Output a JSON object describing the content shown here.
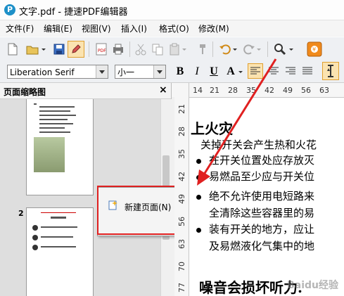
{
  "window": {
    "title": "文字.pdf - 捷速PDF编辑器",
    "app_icon_glyph": "P"
  },
  "menu": [
    {
      "label": "文件(F)"
    },
    {
      "label": "编辑(E)"
    },
    {
      "label": "视图(V)"
    },
    {
      "label": "插入(I)"
    },
    {
      "label": "格式(O)"
    },
    {
      "label": "修改(M)"
    }
  ],
  "toolbar": {
    "font_family": "Liberation Serif",
    "font_size": "小一",
    "bold": "B",
    "italic": "I",
    "underline": "U",
    "text_color": "A"
  },
  "thumbnails": {
    "title": "页面缩略图",
    "close_glyph": "×",
    "page2_number": "2"
  },
  "ruler": {
    "h_ticks": [
      "14",
      "21",
      "28",
      "35",
      "42",
      "49",
      "56",
      "63"
    ],
    "v_ticks": [
      "21",
      "28",
      "35",
      "42",
      "49",
      "56",
      "63",
      "70",
      "77"
    ]
  },
  "document": {
    "heading1": "上火灾",
    "line1": "关掉开关会产生热和火花",
    "bullet1": "在开关位置处应存放灭",
    "bullet2": "易燃品至少应与开关位",
    "bullet3a": "绝不允许使用电短路来",
    "bullet3b": "全清除这些容器里的易",
    "bullet4a": "装有开关的地方，应让",
    "bullet4b": "及易燃液化气集中的地",
    "heading2": "噪音会损坏听力."
  },
  "context_menu": {
    "item_label": "新建页面(N)"
  },
  "colors": {
    "annotation_red": "#e02020",
    "app_icon": "#1e90c8"
  },
  "watermark": "Baidu经验"
}
